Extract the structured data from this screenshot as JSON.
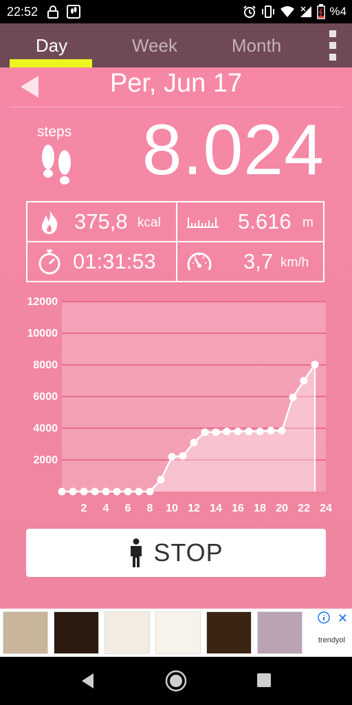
{
  "status_bar": {
    "time": "22:52",
    "battery_text": "%4"
  },
  "tabs": [
    {
      "label": "Day",
      "active": true
    },
    {
      "label": "Week",
      "active": false
    },
    {
      "label": "Month",
      "active": false
    }
  ],
  "date": "Per, Jun 17",
  "steps": {
    "label": "steps",
    "value": "8.024"
  },
  "stats": {
    "calories": {
      "value": "375,8",
      "unit": "kcal",
      "icon": "fire-icon"
    },
    "distance": {
      "value": "5.616",
      "unit": "m",
      "icon": "ruler-icon"
    },
    "duration": {
      "value": "01:31:53",
      "icon": "stopwatch-icon"
    },
    "speed": {
      "value": "3,7",
      "unit": "km/h",
      "icon": "speedometer-icon"
    }
  },
  "chart_data": {
    "type": "area",
    "x": [
      0,
      1,
      2,
      3,
      4,
      5,
      6,
      7,
      8,
      9,
      10,
      11,
      12,
      13,
      14,
      15,
      16,
      17,
      18,
      19,
      20,
      21,
      22,
      23
    ],
    "values": [
      0,
      0,
      0,
      0,
      0,
      0,
      0,
      0,
      0,
      750,
      2200,
      2250,
      3100,
      3750,
      3750,
      3800,
      3800,
      3800,
      3800,
      3850,
      3850,
      5950,
      7000,
      8024
    ],
    "x_tick_labels": [
      "2",
      "4",
      "6",
      "8",
      "10",
      "12",
      "14",
      "16",
      "18",
      "20",
      "22",
      "24"
    ],
    "y_tick_labels": [
      "2000",
      "4000",
      "6000",
      "8000",
      "10000",
      "12000"
    ],
    "ylim": [
      0,
      12000
    ],
    "xlim": [
      0,
      24
    ],
    "grid": true,
    "colors": {
      "line": "#ffffff",
      "fill": "#f6c0ce",
      "grid": "#e86a8c",
      "axis_text": "#ffffff"
    }
  },
  "stop_button": {
    "label": "STOP",
    "icon": "person-icon"
  },
  "ad": {
    "brand": "trendyol"
  },
  "colors": {
    "background": "#f286a2",
    "tabbar": "#6f4a55",
    "tab_indicator": "#ecf521"
  }
}
